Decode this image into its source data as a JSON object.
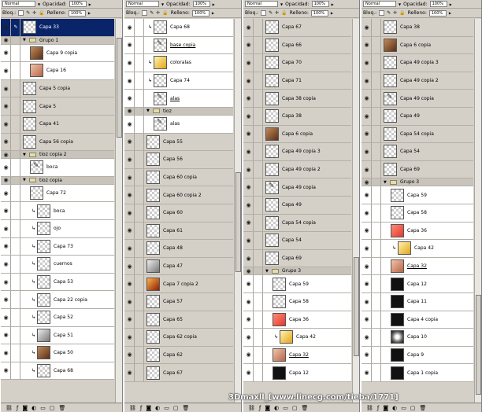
{
  "toolbar": {
    "blend_mode": "Normal",
    "opacity_label": "Opacidad:",
    "opacity_value": "100%",
    "lock_label": "Bloq.:",
    "fill_label": "Relleno:",
    "fill_value": "100%"
  },
  "watermark": "3Dmaxll_[www.linecg.com/tieba/1771]",
  "panels": [
    {
      "scroll_thumb_top": 0.05,
      "layers": [
        {
          "name": "Capa 33",
          "kind": "layer",
          "indent": 0,
          "active": true
        },
        {
          "name": "Grupo 1",
          "kind": "group",
          "indent": 0
        },
        {
          "name": "Capa 9 copia",
          "kind": "layer",
          "indent": 1,
          "thumb": "brown",
          "light": true
        },
        {
          "name": "Capa 16",
          "kind": "layer",
          "indent": 1,
          "thumb": "skin",
          "light": true
        },
        {
          "name": "Capa 5 copia",
          "kind": "layer",
          "indent": 0
        },
        {
          "name": "Capa 5",
          "kind": "layer",
          "indent": 0
        },
        {
          "name": "Capa 41",
          "kind": "layer",
          "indent": 0
        },
        {
          "name": "Capa 56 copia",
          "kind": "layer",
          "indent": 0
        },
        {
          "name": "tioz copia 2",
          "kind": "group",
          "indent": 0
        },
        {
          "name": "boca",
          "kind": "layer",
          "indent": 1,
          "thumb": "mark",
          "light": true
        },
        {
          "name": "tioz copia",
          "kind": "group",
          "indent": 0
        },
        {
          "name": "Capa 72",
          "kind": "layer",
          "indent": 1,
          "light": true
        },
        {
          "name": "boca",
          "kind": "layer",
          "indent": 2,
          "clip": true,
          "light": true
        },
        {
          "name": "ojo",
          "kind": "layer",
          "indent": 2,
          "clip": true,
          "light": true
        },
        {
          "name": "Capa 73",
          "kind": "layer",
          "indent": 2,
          "clip": true,
          "light": true
        },
        {
          "name": "cuernos",
          "kind": "layer",
          "indent": 2,
          "clip": true,
          "light": true
        },
        {
          "name": "Capa 53",
          "kind": "layer",
          "indent": 2,
          "clip": true,
          "light": true
        },
        {
          "name": "Capa 22 copia",
          "kind": "layer",
          "indent": 2,
          "clip": true,
          "light": true
        },
        {
          "name": "Capa 52",
          "kind": "layer",
          "indent": 2,
          "clip": true,
          "light": true
        },
        {
          "name": "Capa 51",
          "kind": "layer",
          "indent": 2,
          "clip": true,
          "thumb": "grey",
          "light": true
        },
        {
          "name": "Capa 50",
          "kind": "layer",
          "indent": 2,
          "clip": true,
          "thumb": "brown",
          "light": true
        },
        {
          "name": "Capa 68",
          "kind": "layer",
          "indent": 2,
          "clip": true,
          "light": true
        }
      ]
    },
    {
      "scroll_thumb_top": 0.4,
      "layers": [
        {
          "name": "Capa 68",
          "kind": "layer",
          "indent": 1,
          "clip": true,
          "light": true
        },
        {
          "name": "base copia",
          "kind": "layer",
          "indent": 1,
          "thumb": "mark",
          "underline": true,
          "light": true
        },
        {
          "name": "coloralas",
          "kind": "layer",
          "indent": 1,
          "clip": true,
          "thumb": "gold",
          "light": true
        },
        {
          "name": "Capa 74",
          "kind": "layer",
          "indent": 1,
          "clip": true,
          "light": true
        },
        {
          "name": "alas",
          "kind": "layer",
          "indent": 1,
          "thumb": "mark",
          "underline": true,
          "light": true
        },
        {
          "name": "tioz",
          "kind": "group",
          "indent": 0
        },
        {
          "name": "alas",
          "kind": "layer",
          "indent": 1,
          "thumb": "mark",
          "light": true
        },
        {
          "name": "Capa 55",
          "kind": "layer",
          "indent": 0
        },
        {
          "name": "Capa 56",
          "kind": "layer",
          "indent": 0
        },
        {
          "name": "Capa 60 copia",
          "kind": "layer",
          "indent": 0
        },
        {
          "name": "Capa 60 copia 2",
          "kind": "layer",
          "indent": 0
        },
        {
          "name": "Capa 60",
          "kind": "layer",
          "indent": 0
        },
        {
          "name": "Capa 61",
          "kind": "layer",
          "indent": 0
        },
        {
          "name": "Capa 48",
          "kind": "layer",
          "indent": 0
        },
        {
          "name": "Capa 47",
          "kind": "layer",
          "indent": 0,
          "thumb": "grey"
        },
        {
          "name": "Capa 7 copia 2",
          "kind": "layer",
          "indent": 0,
          "thumb": "fire"
        },
        {
          "name": "Capa 57",
          "kind": "layer",
          "indent": 0
        },
        {
          "name": "Capa 65",
          "kind": "layer",
          "indent": 0
        },
        {
          "name": "Capa 62 copia",
          "kind": "layer",
          "indent": 0
        },
        {
          "name": "Capa 62",
          "kind": "layer",
          "indent": 0
        },
        {
          "name": "Capa 67",
          "kind": "layer",
          "indent": 0
        }
      ]
    },
    {
      "scroll_thumb_top": 0.62,
      "layers": [
        {
          "name": "Capa 67",
          "kind": "layer",
          "indent": 0
        },
        {
          "name": "Capa 66",
          "kind": "layer",
          "indent": 0
        },
        {
          "name": "Capa 70",
          "kind": "layer",
          "indent": 0
        },
        {
          "name": "Capa 71",
          "kind": "layer",
          "indent": 0
        },
        {
          "name": "Capa 38 copia",
          "kind": "layer",
          "indent": 0
        },
        {
          "name": "Capa 38",
          "kind": "layer",
          "indent": 0
        },
        {
          "name": "Capa 6 copia",
          "kind": "layer",
          "indent": 0,
          "thumb": "brown"
        },
        {
          "name": "Capa 49 copia 3",
          "kind": "layer",
          "indent": 0
        },
        {
          "name": "Capa 49 copia 2",
          "kind": "layer",
          "indent": 0
        },
        {
          "name": "Capa 49 copia",
          "kind": "layer",
          "indent": 0,
          "thumb": "mark"
        },
        {
          "name": "Capa 49",
          "kind": "layer",
          "indent": 0
        },
        {
          "name": "Capa 54 copia",
          "kind": "layer",
          "indent": 0
        },
        {
          "name": "Capa 54",
          "kind": "layer",
          "indent": 0
        },
        {
          "name": "Capa 69",
          "kind": "layer",
          "indent": 0
        },
        {
          "name": "Grupo 3",
          "kind": "group",
          "indent": 0
        },
        {
          "name": "Capa 59",
          "kind": "layer",
          "indent": 1,
          "light": true
        },
        {
          "name": "Capa 58",
          "kind": "layer",
          "indent": 1,
          "light": true
        },
        {
          "name": "Capa 36",
          "kind": "layer",
          "indent": 1,
          "thumb": "red",
          "light": true
        },
        {
          "name": "Capa 42",
          "kind": "layer",
          "indent": 2,
          "clip": true,
          "thumb": "gold",
          "light": true
        },
        {
          "name": "Capa 32",
          "kind": "layer",
          "indent": 1,
          "thumb": "skin",
          "underline": true,
          "light": true
        },
        {
          "name": "Capa 12",
          "kind": "layer",
          "indent": 1,
          "thumb": "dark",
          "light": true
        }
      ]
    },
    {
      "scroll_thumb_top": 0.72,
      "layers": [
        {
          "name": "Capa 38",
          "kind": "layer",
          "indent": 0
        },
        {
          "name": "Capa 6 copia",
          "kind": "layer",
          "indent": 0,
          "thumb": "brown"
        },
        {
          "name": "Capa 49 copia 3",
          "kind": "layer",
          "indent": 0
        },
        {
          "name": "Capa 49 copia 2",
          "kind": "layer",
          "indent": 0
        },
        {
          "name": "Capa 49 copia",
          "kind": "layer",
          "indent": 0,
          "thumb": "mark"
        },
        {
          "name": "Capa 49",
          "kind": "layer",
          "indent": 0
        },
        {
          "name": "Capa 54 copia",
          "kind": "layer",
          "indent": 0
        },
        {
          "name": "Capa 54",
          "kind": "layer",
          "indent": 0
        },
        {
          "name": "Capa 69",
          "kind": "layer",
          "indent": 0
        },
        {
          "name": "Grupo 3",
          "kind": "group",
          "indent": 0
        },
        {
          "name": "Capa 59",
          "kind": "layer",
          "indent": 1,
          "light": true
        },
        {
          "name": "Capa 58",
          "kind": "layer",
          "indent": 1,
          "light": true
        },
        {
          "name": "Capa 36",
          "kind": "layer",
          "indent": 1,
          "thumb": "red",
          "light": true
        },
        {
          "name": "Capa 42",
          "kind": "layer",
          "indent": 2,
          "clip": true,
          "thumb": "gold",
          "light": true
        },
        {
          "name": "Capa 32",
          "kind": "layer",
          "indent": 1,
          "thumb": "skin",
          "underline": true,
          "light": true
        },
        {
          "name": "Capa 12",
          "kind": "layer",
          "indent": 1,
          "thumb": "dark",
          "light": true
        },
        {
          "name": "Capa 11",
          "kind": "layer",
          "indent": 1,
          "thumb": "dark",
          "light": true
        },
        {
          "name": "Capa 4 copia",
          "kind": "layer",
          "indent": 1,
          "thumb": "dark",
          "light": true
        },
        {
          "name": "Capa 10",
          "kind": "layer",
          "indent": 1,
          "thumb": "glow",
          "light": true
        },
        {
          "name": "Capa 9",
          "kind": "layer",
          "indent": 1,
          "thumb": "dark",
          "light": true
        },
        {
          "name": "Capa 1 copia",
          "kind": "layer",
          "indent": 1,
          "thumb": "dark",
          "light": true
        }
      ]
    }
  ]
}
